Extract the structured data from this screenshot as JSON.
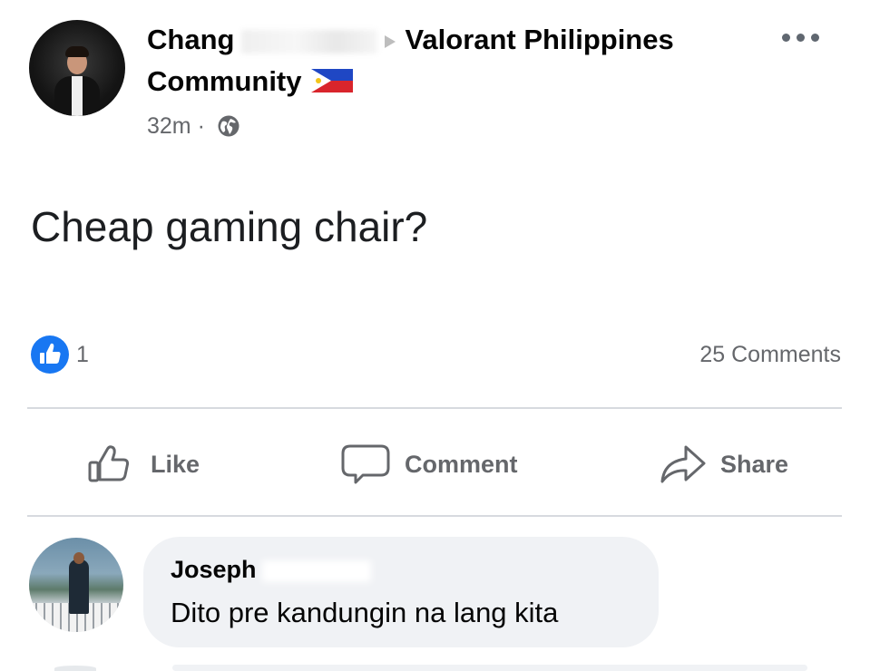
{
  "post": {
    "author_name": "Chang",
    "group_name": "Valorant Philippines",
    "group_suffix": "Community",
    "timestamp": "32m",
    "separator": "·",
    "privacy_icon": "globe-icon",
    "text": "Cheap gaming chair?",
    "more_icon": "more-options-icon"
  },
  "reactions": {
    "icon": "like-reaction-icon",
    "count": "1",
    "comments": "25 Comments"
  },
  "actions": {
    "like_label": "Like",
    "comment_label": "Comment",
    "share_label": "Share"
  },
  "comment": {
    "author": "Joseph",
    "text": "Dito pre kandungin na lang kita"
  },
  "colors": {
    "facebook_blue": "#1877f2",
    "secondary_text": "#65676b",
    "bubble_bg": "#f0f2f5",
    "divider": "#d7dadf"
  }
}
